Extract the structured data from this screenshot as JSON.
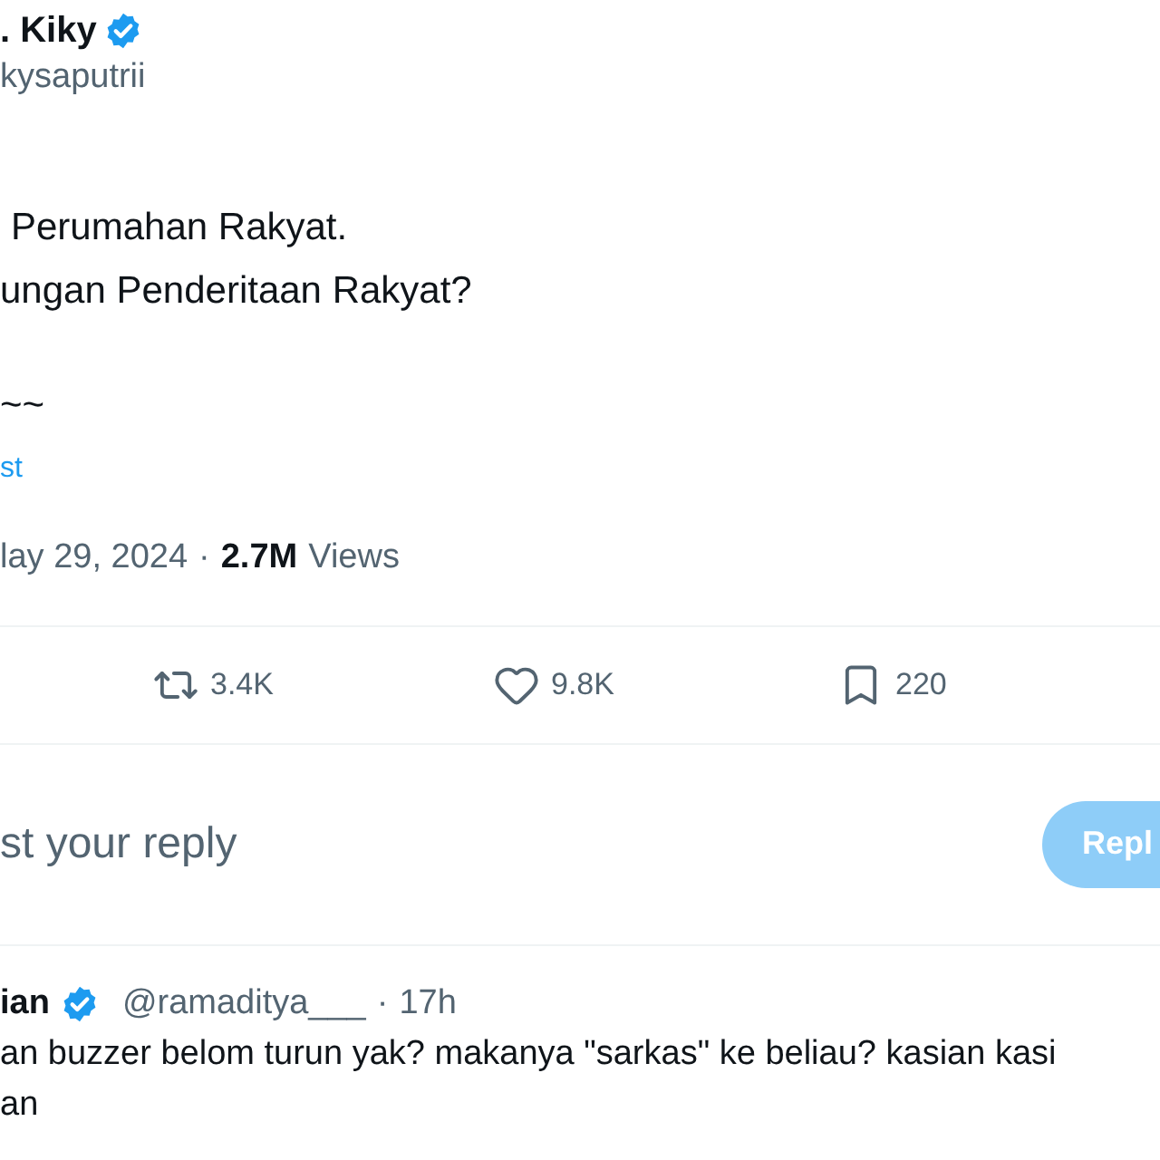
{
  "author": {
    "name": ". Kiky",
    "verified": true,
    "handle": "kysaputrii"
  },
  "tweet": {
    "lines": [
      "Perumahan Rakyat.",
      "ungan Penderitaan Rakyat?",
      "~~"
    ],
    "link": "st"
  },
  "meta": {
    "date": "lay 29, 2024",
    "separator": "·",
    "views_count": "2.7M",
    "views_label": "Views"
  },
  "actions": [
    {
      "kind": "repost",
      "count": "3.4K"
    },
    {
      "kind": "like",
      "count": "9.8K"
    },
    {
      "kind": "bookmark",
      "count": "220"
    }
  ],
  "composer": {
    "placeholder": "st your reply",
    "button": "Repl"
  },
  "reply": {
    "name": "ian",
    "verified": true,
    "handle": "@ramaditya___",
    "separator": "·",
    "time": "17h",
    "lines": [
      "an buzzer belom turun yak? makanya \"sarkas\" ke beliau? kasian kasi",
      "an"
    ]
  }
}
